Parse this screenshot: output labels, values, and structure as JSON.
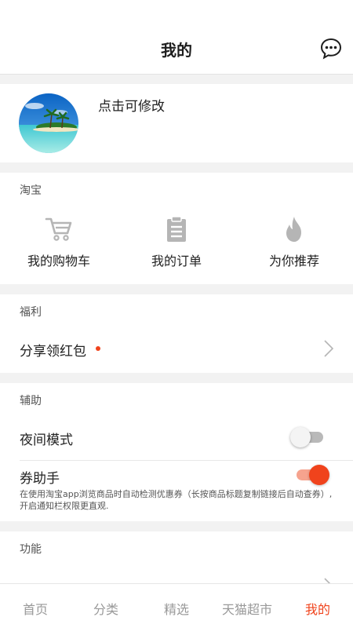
{
  "header": {
    "title": "我的",
    "message_icon": "chat-bubble-icon"
  },
  "profile": {
    "name": "点击可修改",
    "avatar_icon": "beach-avatar-image"
  },
  "taobao": {
    "title": "淘宝",
    "items": [
      {
        "label": "我的购物车",
        "icon": "cart-icon"
      },
      {
        "label": "我的订单",
        "icon": "clipboard-icon"
      },
      {
        "label": "为你推荐",
        "icon": "flame-icon"
      }
    ]
  },
  "fuli": {
    "title": "福利",
    "share_label": "分享领红包"
  },
  "fuzhu": {
    "title": "辅助",
    "night_mode_label": "夜间模式",
    "night_mode_on": false,
    "coupon_label": "券助手",
    "coupon_on": true,
    "coupon_desc": "在使用淘宝app浏览商品时自动检测优惠券（长按商品标题复制链接后自动查券）,开启通知栏权限更直观."
  },
  "gongneng": {
    "title": "功能"
  },
  "tabbar": {
    "tabs": [
      {
        "label": "首页",
        "active": false
      },
      {
        "label": "分类",
        "active": false
      },
      {
        "label": "精选",
        "active": false
      },
      {
        "label": "天猫超市",
        "active": false
      },
      {
        "label": "我的",
        "active": true
      }
    ]
  },
  "colors": {
    "accent": "#f0431c",
    "inactive_tab": "#999999",
    "background": "#f2f2f2"
  }
}
